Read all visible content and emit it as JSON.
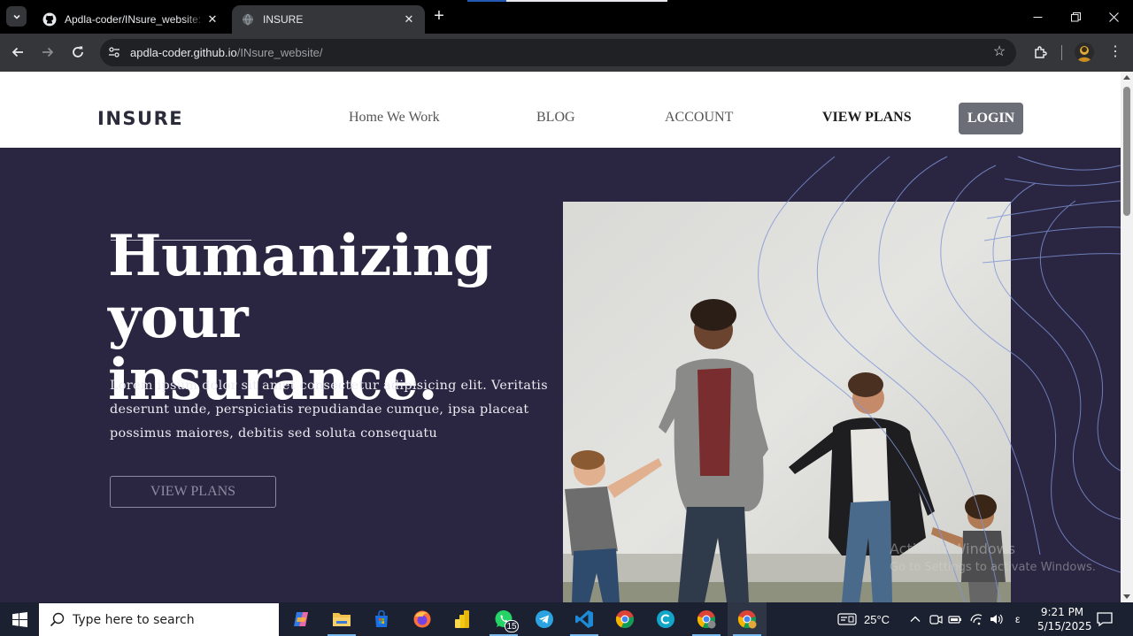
{
  "browser": {
    "tabs": [
      {
        "title": "Apdla-coder/INsure_website: th",
        "favicon": "github-icon",
        "active": false
      },
      {
        "title": "INSURE",
        "favicon": "globe-icon",
        "active": true
      }
    ],
    "url_host": "apdla-coder.github.io",
    "url_path": "/INsure_website/"
  },
  "site": {
    "logo": "INSURE",
    "nav": {
      "home_we_work": "Home We Work",
      "blog": "BLOG",
      "account": "ACCOUNT",
      "view_plans": "VIEW PLANS",
      "login": "LOGIN"
    },
    "hero": {
      "title_line1": "Humanizing",
      "title_line2": "your insurance.",
      "text": "Lorem ipsum dolor sit amet consectetur adipisicing elit. Veritatis deserunt unde, perspiciatis repudiandae cumque, ipsa placeat possimus maiores, debitis sed soluta consequatu",
      "cta": "VIEW PLANS",
      "photo": "family-walking-photo"
    },
    "watermark": {
      "line1": "Activate Windows",
      "line2": "Go to Settings to activate Windows."
    }
  },
  "colors": {
    "hero_bg": "#2a2541",
    "login_bg": "#6b6e76",
    "contour": "#7d94d8"
  },
  "taskbar": {
    "search_placeholder": "Type here to search",
    "whatsapp_badge": "15",
    "temperature": "25°C",
    "time": "9:21 PM",
    "date": "5/15/2025",
    "lang": "ε"
  }
}
